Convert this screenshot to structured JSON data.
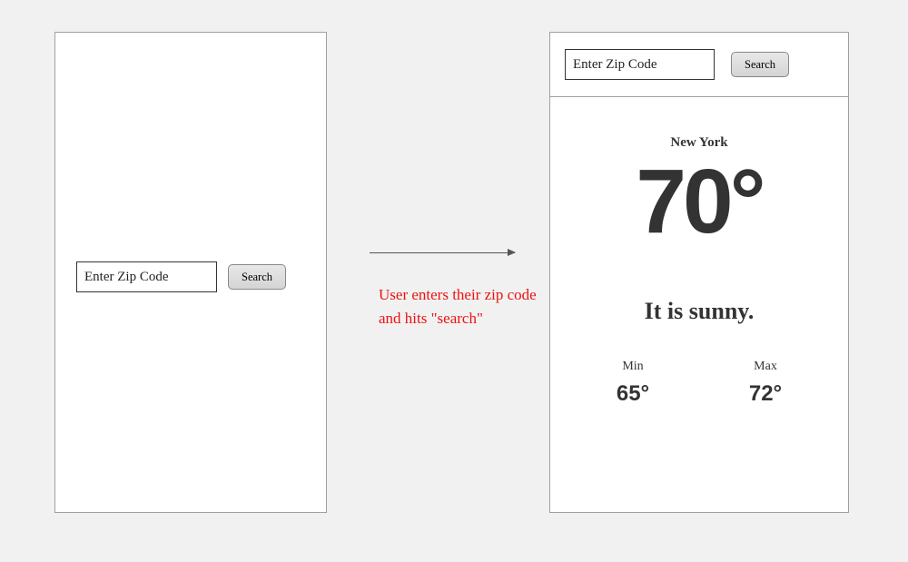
{
  "screen_initial": {
    "zip_placeholder": "Enter Zip Code",
    "search_label": "Search"
  },
  "screen_result": {
    "zip_placeholder": "Enter Zip Code",
    "search_label": "Search",
    "city": "New York",
    "temp_display": "70°",
    "condition": "It is sunny.",
    "min_label": "Min",
    "min_value": "65°",
    "max_label": "Max",
    "max_value": "72°"
  },
  "annotation": "User enters their zip code and hits \"search\""
}
